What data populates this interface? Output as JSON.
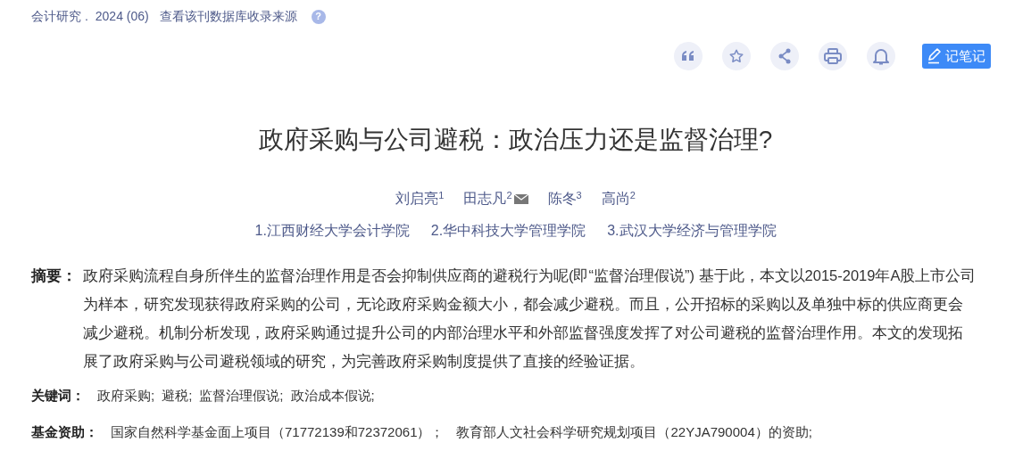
{
  "source": {
    "journal": "会计研究 .",
    "issue": "2024 (06)",
    "link": "查看该刊数据库收录来源",
    "help": "?"
  },
  "toolbar": [
    {
      "kind": "quote"
    },
    {
      "kind": "star"
    },
    {
      "kind": "share"
    },
    {
      "kind": "print"
    },
    {
      "kind": "bell"
    }
  ],
  "note_button": {
    "label": "记笔记"
  },
  "title": "政府采购与公司避税：政治压力还是监督治理?",
  "authors": [
    {
      "name": "刘启亮",
      "sup": "1",
      "mail": false
    },
    {
      "name": "田志凡",
      "sup": "2",
      "mail": true
    },
    {
      "name": "陈冬",
      "sup": "3",
      "mail": false
    },
    {
      "name": "高尚",
      "sup": "2",
      "mail": false
    }
  ],
  "affiliations": [
    "1.江西财经大学会计学院",
    "2.华中科技大学管理学院",
    "3.武汉大学经济与管理学院"
  ],
  "abstract": {
    "label": "摘要：",
    "text": "政府采购流程自身所伴生的监督治理作用是否会抑制供应商的避税行为呢(即“监督治理假说”) 基于此，本文以2015-2019年A股上市公司为样本，研究发现获得政府采购的公司，无论政府采购金额大小，都会减少避税。而且，公开招标的采购以及单独中标的供应商更会减少避税。机制分析发现，政府采购通过提升公司的内部治理水平和外部监督强度发挥了对公司避税的监督治理作用。本文的发现拓展了政府采购与公司避税领域的研究，为完善政府采购制度提供了直接的经验证据。"
  },
  "keywords": {
    "label": "关键词：",
    "items": [
      "政府采购;",
      "避税;",
      "监督治理假说;",
      "政治成本假说;"
    ]
  },
  "funding": {
    "label": "基金资助：",
    "items": [
      "国家自然科学基金面上项目（71772139和72372061）；",
      "教育部人文社会科学研究规划项目（22YJA790004）的资助;"
    ]
  }
}
